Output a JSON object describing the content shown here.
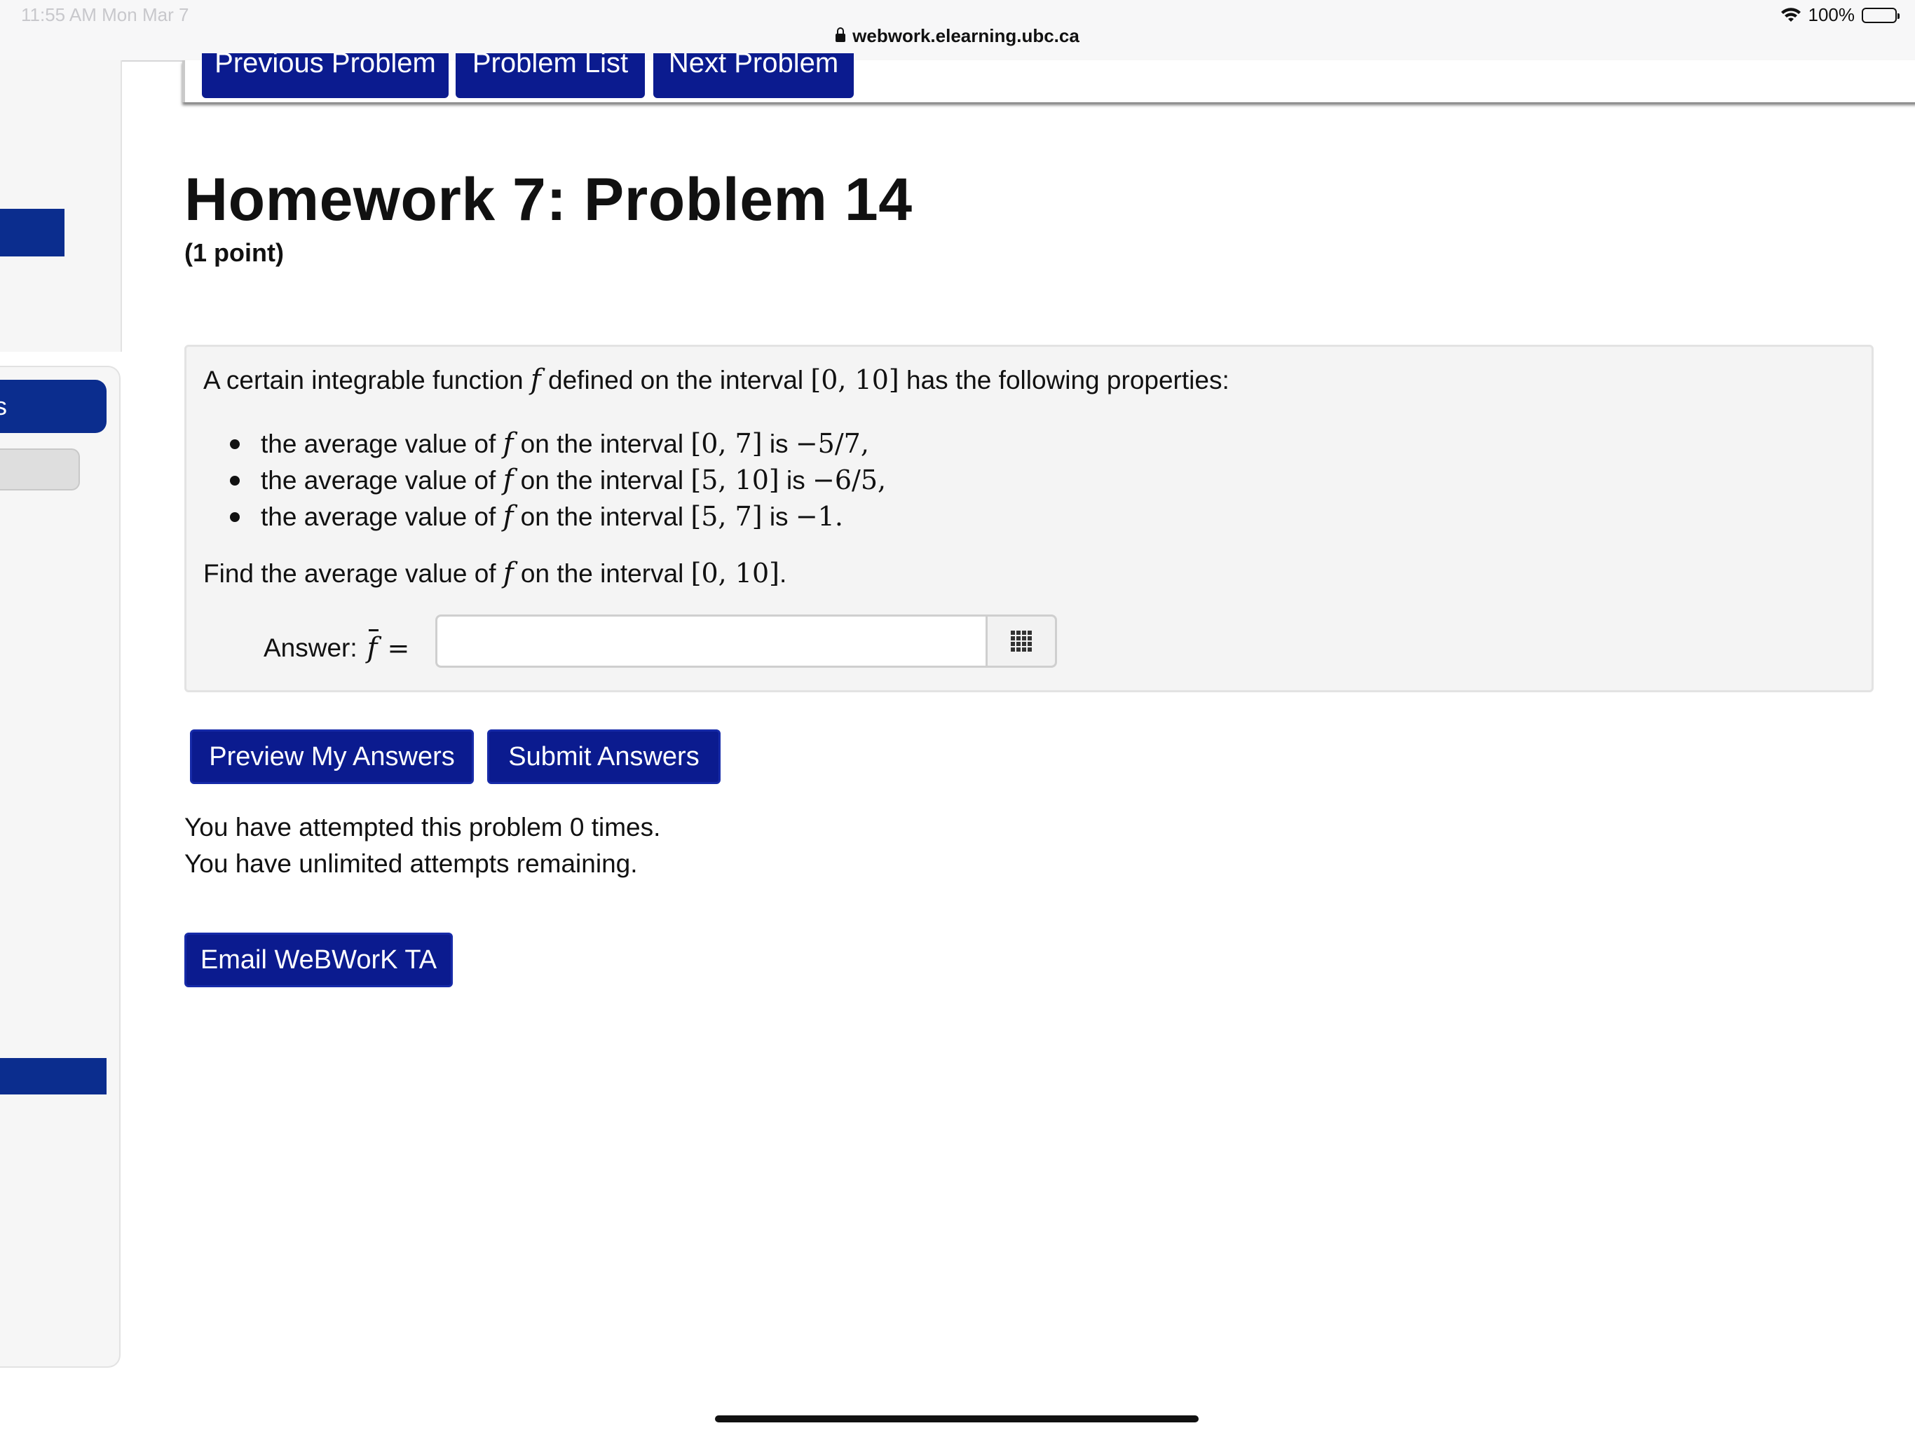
{
  "statusbar": {
    "time": "11:55 AM   Mon Mar 7",
    "battery_text": "100%",
    "battery_level": 1.0,
    "url": "webwork.elearning.ubc.ca"
  },
  "sidebar": {
    "active_fragment": "s"
  },
  "nav": {
    "previous": "Previous Problem",
    "list": "Problem List",
    "next": "Next Problem"
  },
  "page": {
    "title": "Homework 7: Problem 14",
    "points": "(1 point)"
  },
  "problem": {
    "intro_pre": "A certain integrable function ",
    "fn": "f",
    "intro_mid": " defined on the interval ",
    "interval_main": "[0, 10]",
    "intro_post": " has the following properties:",
    "properties": [
      {
        "pre": "the average value of ",
        "fn": "f",
        "mid": " on the interval ",
        "interval": "[0, 7]",
        "is": " is ",
        "value": "−5/7,"
      },
      {
        "pre": "the average value of ",
        "fn": "f",
        "mid": " on the interval ",
        "interval": "[5, 10]",
        "is": " is ",
        "value": "−6/5,"
      },
      {
        "pre": "the average value of ",
        "fn": "f",
        "mid": " on the interval ",
        "interval": "[5, 7]",
        "is": " is ",
        "value": "−1."
      }
    ],
    "find_pre": "Find the average value of ",
    "find_fn": "f",
    "find_mid": " on the interval ",
    "find_interval": "[0, 10]",
    "find_post": ".",
    "answer_label": "Answer:",
    "answer_fn": "f",
    "answer_eq": "=",
    "answer_value": ""
  },
  "actions": {
    "preview": "Preview My Answers",
    "submit": "Submit Answers",
    "email": "Email WeBWorK TA"
  },
  "attempts": {
    "line1": "You have attempted this problem 0 times.",
    "line2": "You have unlimited attempts remaining."
  },
  "colors": {
    "button_blue": "#0b1b8f",
    "sidebar_blue": "#0b2d8e"
  }
}
